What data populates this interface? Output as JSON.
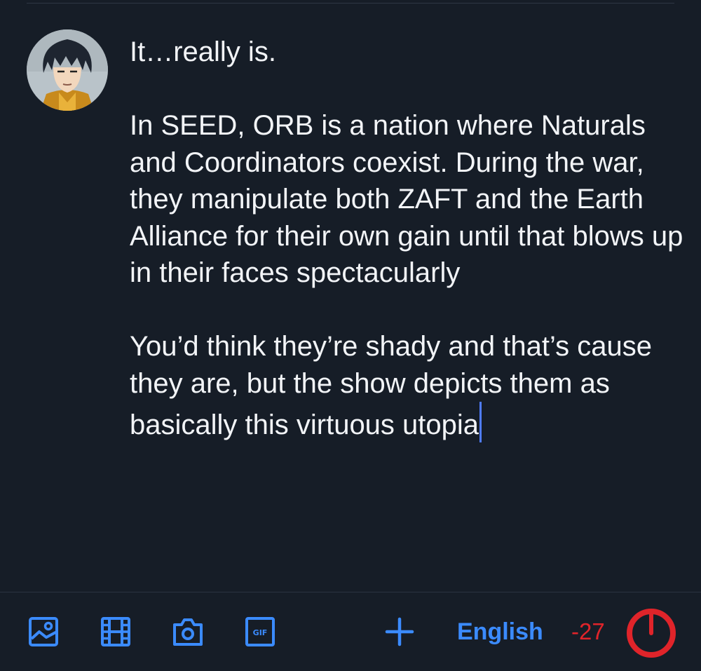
{
  "composer": {
    "paragraphs": [
      "It…really is.",
      "In SEED, ORB is a nation where Naturals and Coordinators coexist. During the war, they manipulate both ZAFT and the Earth Alliance for their own gain until that blows up in their faces spectacularly",
      "You’d think they’re shady and that’s cause they are, but the show depicts them as basically this virtuous utopia"
    ]
  },
  "toolbar": {
    "icons": [
      "image-icon",
      "video-icon",
      "camera-icon",
      "gif-icon",
      "plus-icon"
    ],
    "language": "English",
    "char_count": "-27",
    "char_limit_progress": 1.0
  },
  "colors": {
    "background": "#161d27",
    "text": "#f2f4f7",
    "accent": "#3b8bff",
    "cursor": "#4f7cff",
    "over_limit": "#e0242a"
  }
}
